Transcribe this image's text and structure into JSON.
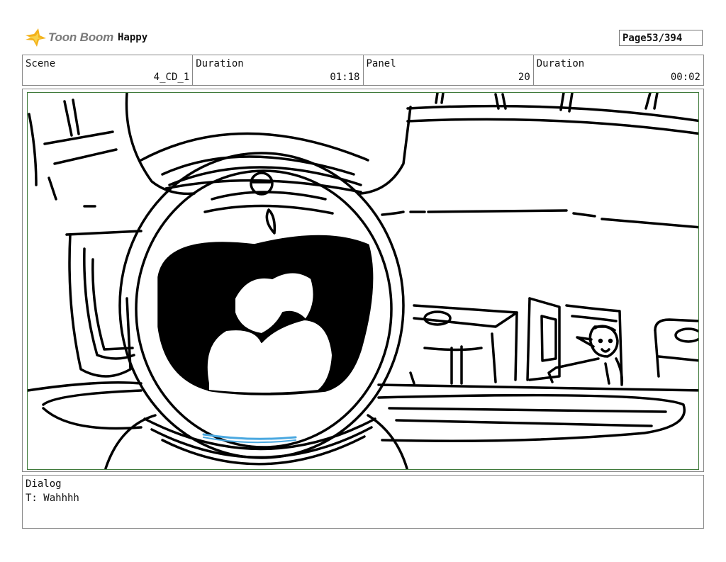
{
  "header": {
    "logo_text": "Toon Boom",
    "project_title": "Happy",
    "page_label": "Page",
    "page_value": "53/394"
  },
  "info": {
    "scene_label": "Scene",
    "scene_value": "4_CD_1",
    "duration_label": "Duration",
    "duration_value": "01:18",
    "panel_label": "Panel",
    "panel_value": "20",
    "panel_duration_label": "Duration",
    "panel_duration_value": "00:02"
  },
  "panel_image": {
    "icon": "storyboard-sketch-astronaut-scream",
    "colors": {
      "frame": "#3f7a3a",
      "ink": "#000000",
      "accent_blue": "#4aa8e0"
    }
  },
  "dialog": {
    "label": "Dialog",
    "text": "T: Wahhhh"
  }
}
